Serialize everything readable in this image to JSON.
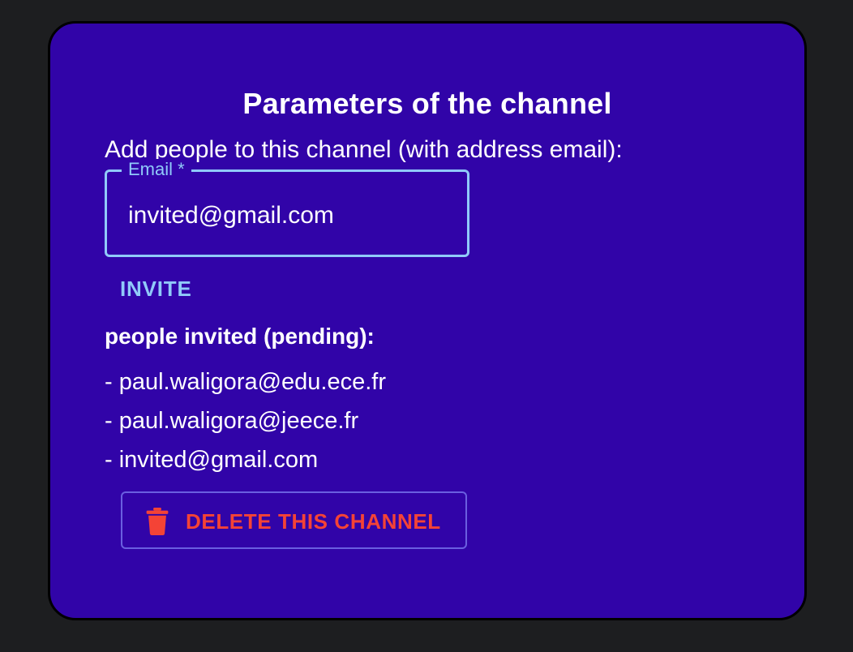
{
  "dialog": {
    "title": "Parameters of the channel",
    "subtitle": "Add people to this channel (with address email):"
  },
  "email_field": {
    "label": "Email *",
    "value": "invited@gmail.com"
  },
  "invite_button": {
    "label": "INVITE"
  },
  "invited": {
    "title": "people invited (pending):",
    "items": [
      "- paul.waligora@edu.ece.fr",
      "- paul.waligora@jeece.fr",
      "- invited@gmail.com"
    ]
  },
  "delete_button": {
    "label": "DELETE THIS CHANNEL",
    "icon": "trash-icon"
  },
  "colors": {
    "background": "#1d1e20",
    "dialog": "#3104a8",
    "accent": "#90caf9",
    "danger": "#f44336"
  }
}
